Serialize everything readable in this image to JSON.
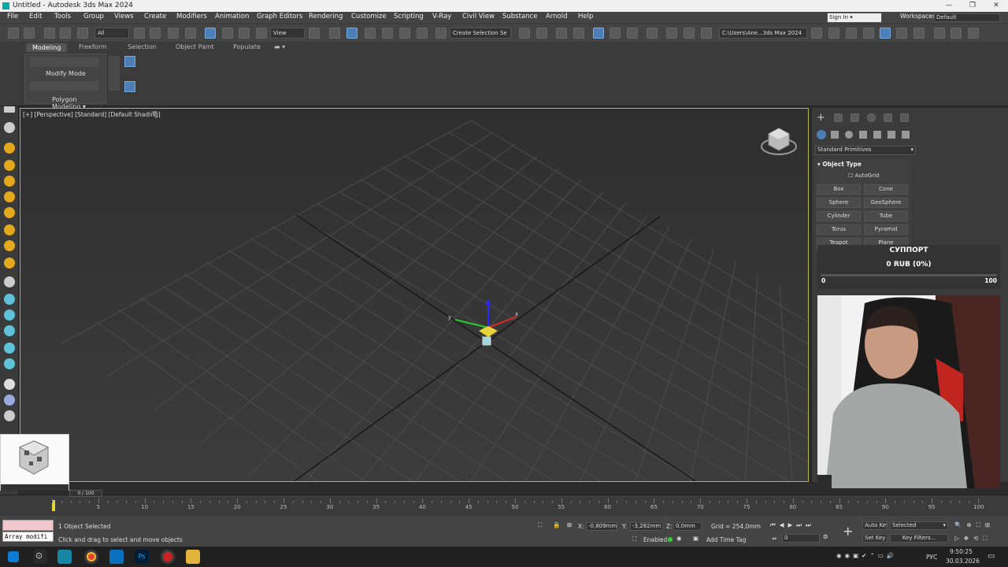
{
  "window": {
    "title": "Untitled - Autodesk 3ds Max 2024"
  },
  "menu": [
    "File",
    "Edit",
    "Tools",
    "Group",
    "Views",
    "Create",
    "Modifiers",
    "Animation",
    "Graph Editors",
    "Rendering",
    "Customize",
    "Scripting",
    "V-Ray",
    "Civil View",
    "Substance",
    "Arnold",
    "Help"
  ],
  "account": {
    "sign_in": "Sign In",
    "workspaces_label": "Workspaces:",
    "workspace": "Default"
  },
  "toolbar": {
    "filter": "All",
    "ref_coord": "View",
    "selection_set": "Create Selection Se",
    "project_path": "C:\\Users\\Ane...3ds Max 2024"
  },
  "ribbon": {
    "tabs": [
      "Modeling",
      "Freeform",
      "Selection",
      "Object Paint",
      "Populate"
    ],
    "modify_mode": "Modify Mode",
    "polygon_modeling": "Polygon Modeling"
  },
  "viewport": {
    "label": "[+] [Perspective] [Standard] [Default Shading]"
  },
  "command_panel": {
    "category": "Standard Primitives",
    "rollout": "Object Type",
    "autogrid": "AutoGrid",
    "primitives": [
      "Box",
      "Cone",
      "Sphere",
      "GeoSphere",
      "Cylinder",
      "Tube",
      "Torus",
      "Pyramid",
      "Teapot",
      "Plane"
    ]
  },
  "donation": {
    "title": "СУППОРТ",
    "amount": "0 RUB (0%)",
    "min": "0",
    "max": "100",
    "progress": 0
  },
  "timeline": {
    "ticks": [
      "5",
      "10",
      "15",
      "20",
      "25",
      "30",
      "35",
      "40",
      "45",
      "50",
      "55",
      "60",
      "65",
      "70",
      "75",
      "80",
      "85",
      "90",
      "95",
      "100"
    ],
    "slider": "0 / 100"
  },
  "status": {
    "script_listener": "Array modifi",
    "selection": "1 Object Selected",
    "prompt": "Click and drag to select and move objects",
    "x_label": "X:",
    "x": "-0,809mm",
    "y_label": "Y:",
    "y": "-3,282mm",
    "z_label": "Z:",
    "z": "0,0mm",
    "grid": "Grid = 254,0mm",
    "enabled": "Enabled:",
    "add_time_tag": "Add Time Tag",
    "frame": "0",
    "auto_key": "Auto Key",
    "selected": "Selected",
    "set_key": "Set Key",
    "key_filters": "Key Filters..."
  },
  "taskbar": {
    "lang": "РУС",
    "time": "9:50:25",
    "date": "30.03.2026"
  },
  "colors": {
    "viewport_border": "#b9b246",
    "accent": "#4b7fb5"
  }
}
